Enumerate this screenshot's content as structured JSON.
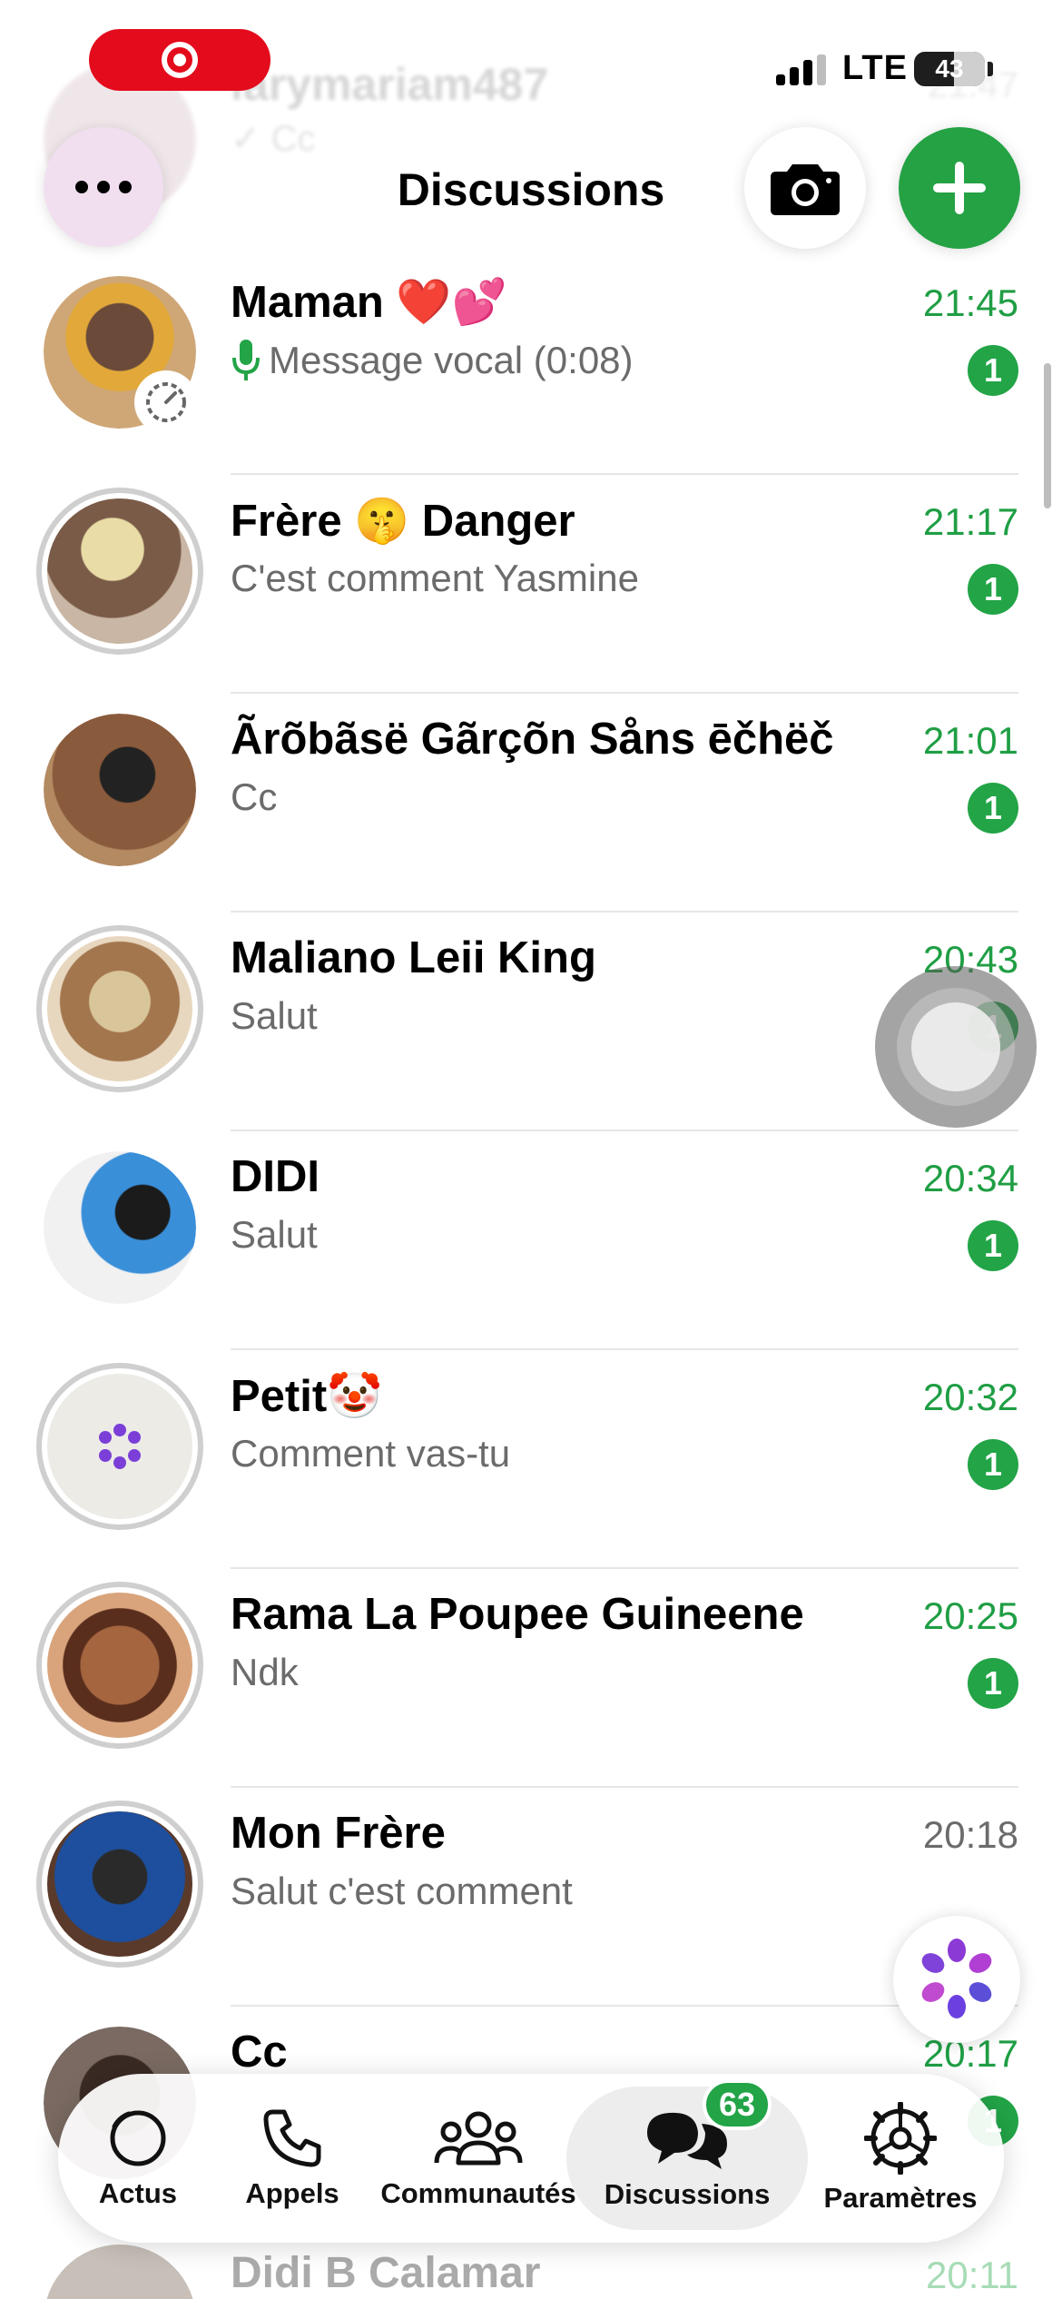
{
  "status_bar": {
    "network": "LTE",
    "battery": "43"
  },
  "ghost_row": {
    "name": "larymariam487",
    "message": "✓ Cc",
    "time": "21:47"
  },
  "header": {
    "title": "Discussions"
  },
  "chats": [
    {
      "name": "Maman ❤️💕",
      "message": "Message vocal (0:08)",
      "time": "21:45",
      "unread": "1",
      "voice": true
    },
    {
      "name": "Frère 🤫 Danger",
      "message": "C'est comment Yasmine",
      "time": "21:17",
      "unread": "1"
    },
    {
      "name": "Ãrõbãsë Gãrçõn Såns ēčhëč",
      "message": "Cc",
      "time": "21:01",
      "unread": "1"
    },
    {
      "name": "Maliano Leii King",
      "message": "Salut",
      "time": "20:43",
      "unread": "1"
    },
    {
      "name": "DIDI",
      "message": "Salut",
      "time": "20:34",
      "unread": "1"
    },
    {
      "name": "Petit🤡",
      "message": "Comment vas-tu",
      "time": "20:32",
      "unread": "1"
    },
    {
      "name": "Rama La Poupee Guineene",
      "message": "Ndk",
      "time": "20:25",
      "unread": "1"
    },
    {
      "name": "Mon Frère",
      "message": "Salut c'est comment",
      "time": "20:18",
      "unread": ""
    },
    {
      "name": "Cc",
      "message": "",
      "time": "20:17",
      "unread": "1"
    }
  ],
  "partial_chat": {
    "name": "Didi B Calamar",
    "time": "20:11"
  },
  "tabs": [
    {
      "label": "Actus",
      "icon": "status-icon"
    },
    {
      "label": "Appels",
      "icon": "phone-icon"
    },
    {
      "label": "Communautés",
      "icon": "communities-icon"
    },
    {
      "label": "Discussions",
      "icon": "chats-icon",
      "badge": "63",
      "active": true
    },
    {
      "label": "Paramètres",
      "icon": "gear-icon"
    }
  ],
  "colors": {
    "accent_green": "#25a244",
    "record_red": "#e30b1c"
  }
}
